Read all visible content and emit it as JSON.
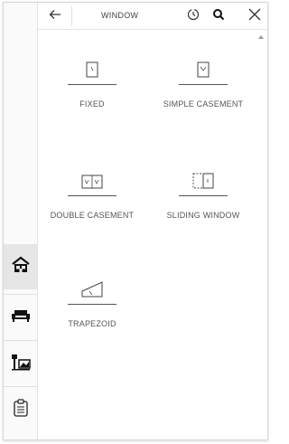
{
  "header": {
    "title": "WINDOW",
    "back_icon": "arrow-left-icon",
    "history_icon": "history-icon",
    "search_icon": "search-icon",
    "close_icon": "close-icon"
  },
  "sidebar": {
    "items": [
      {
        "icon": "house-icon",
        "active": true
      },
      {
        "icon": "sofa-icon",
        "active": false
      },
      {
        "icon": "desk-lamp-icon",
        "active": false
      },
      {
        "icon": "clipboard-icon",
        "active": false
      }
    ]
  },
  "catalog": {
    "items": [
      {
        "label": "FIXED",
        "icon": "fixed-window-icon"
      },
      {
        "label": "SIMPLE CASEMENT",
        "icon": "simple-casement-icon"
      },
      {
        "label": "DOUBLE CASEMENT",
        "icon": "double-casement-icon"
      },
      {
        "label": "SLIDING WINDOW",
        "icon": "sliding-window-icon"
      },
      {
        "label": "TRAPEZOID",
        "icon": "trapezoid-window-icon"
      }
    ]
  },
  "colors": {
    "active_sidebar_bg": "#e6e6e6",
    "icon_dark": "#222222",
    "text": "#555555"
  }
}
